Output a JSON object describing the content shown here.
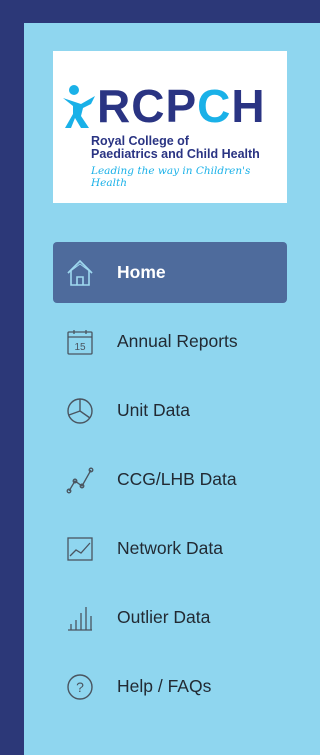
{
  "logo": {
    "word_dark": "RCP",
    "word_cyan": "C",
    "word_end": "H",
    "subtitle_line1": "Royal College of",
    "subtitle_line2": "Paediatrics and Child Health",
    "tagline": "Leading the way in Children's Health"
  },
  "nav": {
    "items": [
      {
        "label": "Home",
        "icon": "home-icon",
        "active": true
      },
      {
        "label": "Annual Reports",
        "icon": "calendar-icon",
        "icon_text": "15"
      },
      {
        "label": "Unit Data",
        "icon": "pie-chart-icon"
      },
      {
        "label": "CCG/LHB Data",
        "icon": "scatter-line-icon"
      },
      {
        "label": "Network Data",
        "icon": "area-chart-icon"
      },
      {
        "label": "Outlier Data",
        "icon": "bar-chart-icon"
      },
      {
        "label": "Help / FAQs",
        "icon": "help-icon"
      }
    ]
  },
  "colors": {
    "page_background": "#2c3878",
    "sidebar_background": "#8fd6ef",
    "active_item": "#4e6b9c",
    "brand_navy": "#2a3483",
    "brand_cyan": "#1ab1e8"
  }
}
